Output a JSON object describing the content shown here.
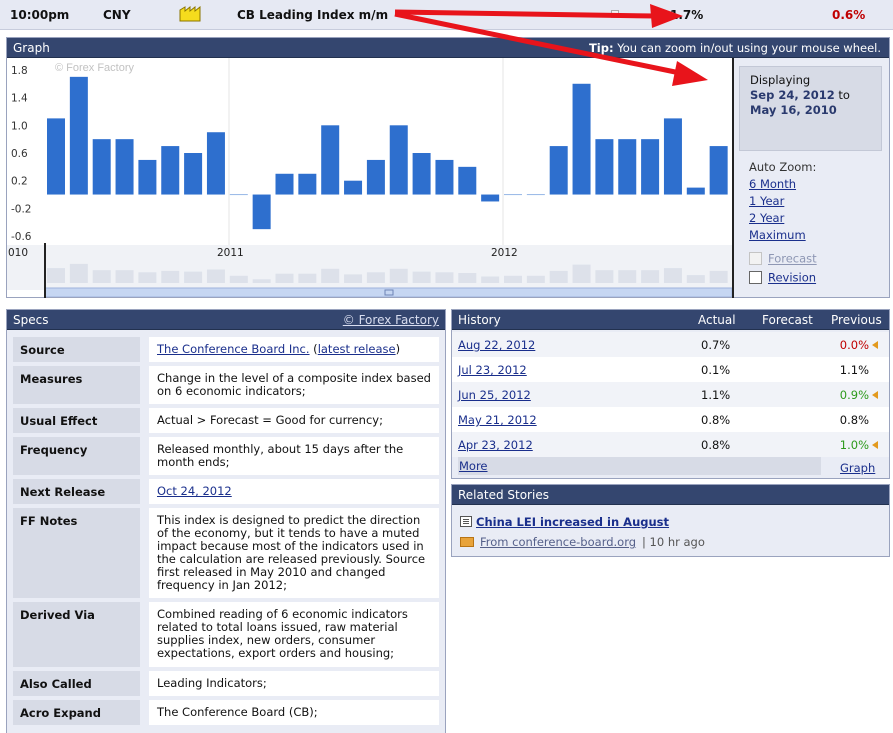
{
  "event": {
    "time": "10:00pm",
    "currency": "CNY",
    "impact_icon": "folder-impact-icon",
    "title": "CB Leading Index m/m",
    "actual": "1.7%",
    "previous": "0.6%"
  },
  "graph": {
    "header": "Graph",
    "tip_bold": "Tip:",
    "tip_text": " You can zoom in/out using your mouse wheel.",
    "watermark": "© Forex Factory",
    "displaying_label": "Displaying",
    "range_from": "Sep 24, 2012",
    "range_to_word": " to",
    "range_to": "May 16, 2010",
    "auto_zoom_label": "Auto Zoom:",
    "zoom_options": [
      "6 Month",
      "1 Year",
      "2 Year",
      "Maximum"
    ],
    "forecast_label": "Forecast",
    "revision_label": "Revision"
  },
  "chart_data": {
    "type": "bar",
    "y_ticks": [
      "1.8",
      "1.4",
      "1.0",
      "0.6",
      "0.2",
      "-0.2",
      "-0.6"
    ],
    "x_labels": [
      "010",
      "2011",
      "2012"
    ],
    "values": [
      1.1,
      1.7,
      0.8,
      0.8,
      0.5,
      0.7,
      0.6,
      0.9,
      0.0,
      -0.5,
      0.3,
      0.3,
      1.0,
      0.2,
      0.5,
      1.0,
      0.6,
      0.5,
      0.4,
      -0.1,
      0.0,
      0.0,
      0.7,
      1.6,
      0.8,
      0.8,
      0.8,
      1.1,
      0.1,
      0.7,
      1.7
    ],
    "ylim": [
      -0.7,
      1.9
    ],
    "color": "#2e6fce",
    "grid": true
  },
  "specs": {
    "header": "Specs",
    "header_link": "© Forex Factory",
    "rows": [
      {
        "key": "Source",
        "value": "The Conference Board Inc.",
        "extra_open": " (",
        "extra_link": "latest release",
        "extra_close": ")"
      },
      {
        "key": "Measures",
        "value": "Change in the level of a composite index based on 6 economic indicators;"
      },
      {
        "key": "Usual Effect",
        "value": "Actual > Forecast = Good for currency;"
      },
      {
        "key": "Frequency",
        "value": "Released monthly, about 15 days after the month ends;"
      },
      {
        "key": "Next Release",
        "value": "Oct 24, 2012"
      },
      {
        "key": "FF Notes",
        "value": "This index is designed to predict the direction of the economy, but it tends to have a muted impact because most of the indicators used in the calculation are released previously. Source first released in May 2010 and changed frequency in Jan 2012;"
      },
      {
        "key": "Derived Via",
        "value": "Combined reading of 6 economic indicators related to total loans issued, raw material supplies index, new orders, consumer expectations, export orders and housing;"
      },
      {
        "key": "Also Called",
        "value": "Leading Indicators;"
      },
      {
        "key": "Acro Expand",
        "value": "The Conference Board (CB);"
      }
    ]
  },
  "history": {
    "header": "History",
    "col_actual": "Actual",
    "col_forecast": "Forecast",
    "col_previous": "Previous",
    "rows": [
      {
        "date": "Aug 22, 2012",
        "actual": "0.7%",
        "previous": "0.0%",
        "prev_color": "#c00000",
        "revised": true
      },
      {
        "date": "Jul 23, 2012",
        "actual": "0.1%",
        "previous": "1.1%",
        "prev_color": "#111111",
        "revised": false
      },
      {
        "date": "Jun 25, 2012",
        "actual": "1.1%",
        "previous": "0.9%",
        "prev_color": "#2d9a1c",
        "revised": true
      },
      {
        "date": "May 21, 2012",
        "actual": "0.8%",
        "previous": "0.8%",
        "prev_color": "#111111",
        "revised": false
      },
      {
        "date": "Apr 23, 2012",
        "actual": "0.8%",
        "previous": "1.0%",
        "prev_color": "#2d9a1c",
        "revised": true
      }
    ],
    "more_label": "More",
    "graph_label": "Graph"
  },
  "related": {
    "header": "Related Stories",
    "story_title": "China LEI increased in August",
    "source": "From conference-board.org",
    "time": " | 10 hr ago"
  }
}
